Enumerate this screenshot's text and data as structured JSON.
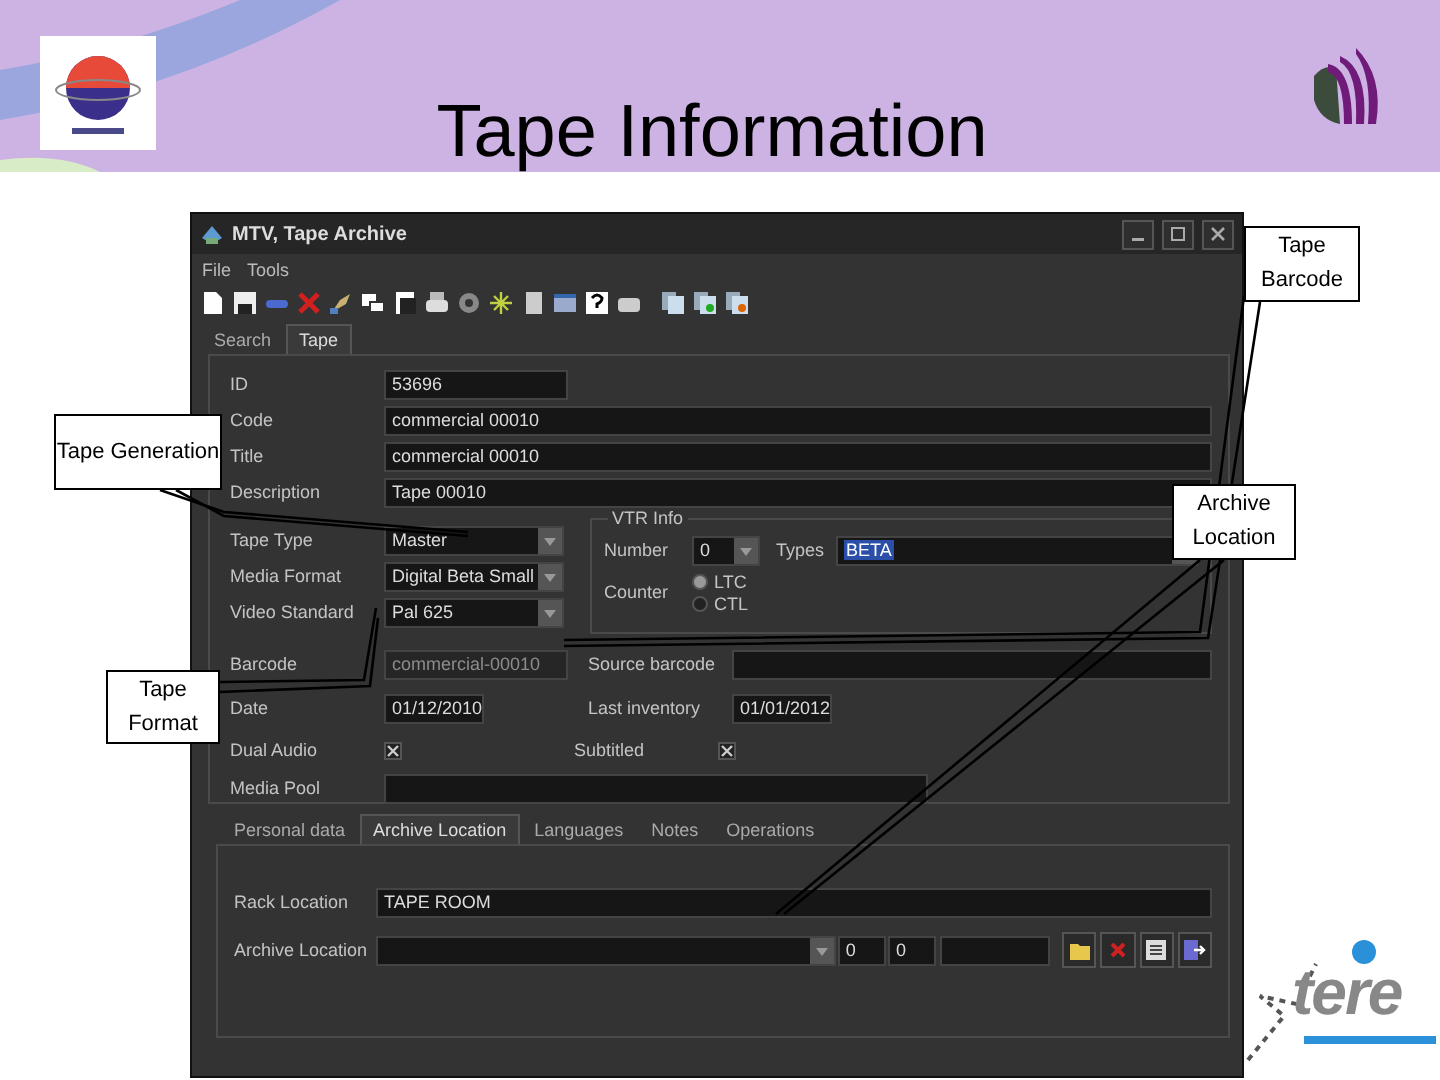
{
  "slide": {
    "title": "Tape Information",
    "brand": "tere"
  },
  "window": {
    "title": "MTV, Tape Archive"
  },
  "menu": [
    "File",
    "Tools"
  ],
  "tabs": [
    {
      "label": "Search",
      "selected": false
    },
    {
      "label": "Tape",
      "selected": true
    }
  ],
  "form": {
    "id": {
      "label": "ID",
      "value": "53696"
    },
    "code": {
      "label": "Code",
      "value": "commercial 00010"
    },
    "title": {
      "label": "Title",
      "value": "commercial 00010"
    },
    "description": {
      "label": "Description",
      "value": "Tape 00010"
    },
    "tape_type": {
      "label": "Tape Type",
      "value": "Master"
    },
    "media_format": {
      "label": "Media Format",
      "value": "Digital Beta Small"
    },
    "video_standard": {
      "label": "Video Standard",
      "value": "Pal 625"
    },
    "vtr_info": {
      "title": "VTR Info",
      "number_label": "Number",
      "number": "0",
      "types_label": "Types",
      "types": "BETA",
      "counter_label": "Counter",
      "counter_options": [
        {
          "label": "LTC",
          "selected": true
        },
        {
          "label": "CTL",
          "selected": false
        }
      ]
    },
    "barcode": {
      "label": "Barcode",
      "value": "commercial-00010",
      "disabled": true
    },
    "source_barcode": {
      "label": "Source barcode"
    },
    "date": {
      "label": "Date",
      "value": "01/12/2010"
    },
    "last_inventory": {
      "label": "Last inventory",
      "value": "01/01/2012"
    },
    "dual_audio": {
      "label": "Dual Audio",
      "checked": true
    },
    "subtitled": {
      "label": "Subtitled",
      "checked": true
    },
    "media_pool": {
      "label": "Media Pool"
    }
  },
  "subtabs": [
    {
      "label": "Personal data",
      "selected": false
    },
    {
      "label": "Archive Location",
      "selected": true
    },
    {
      "label": "Languages",
      "selected": false
    },
    {
      "label": "Notes",
      "selected": false
    },
    {
      "label": "Operations",
      "selected": false
    }
  ],
  "rack_location": {
    "label": "Rack Location",
    "value": "TAPE ROOM"
  },
  "archive_location": {
    "label": "Archive Location",
    "values": [
      "0",
      "0"
    ]
  },
  "callouts": [
    {
      "text": "Tape Barcode"
    },
    {
      "text": "Tape Generation"
    },
    {
      "text": "Archive Location"
    },
    {
      "text": "Tape Format"
    }
  ]
}
